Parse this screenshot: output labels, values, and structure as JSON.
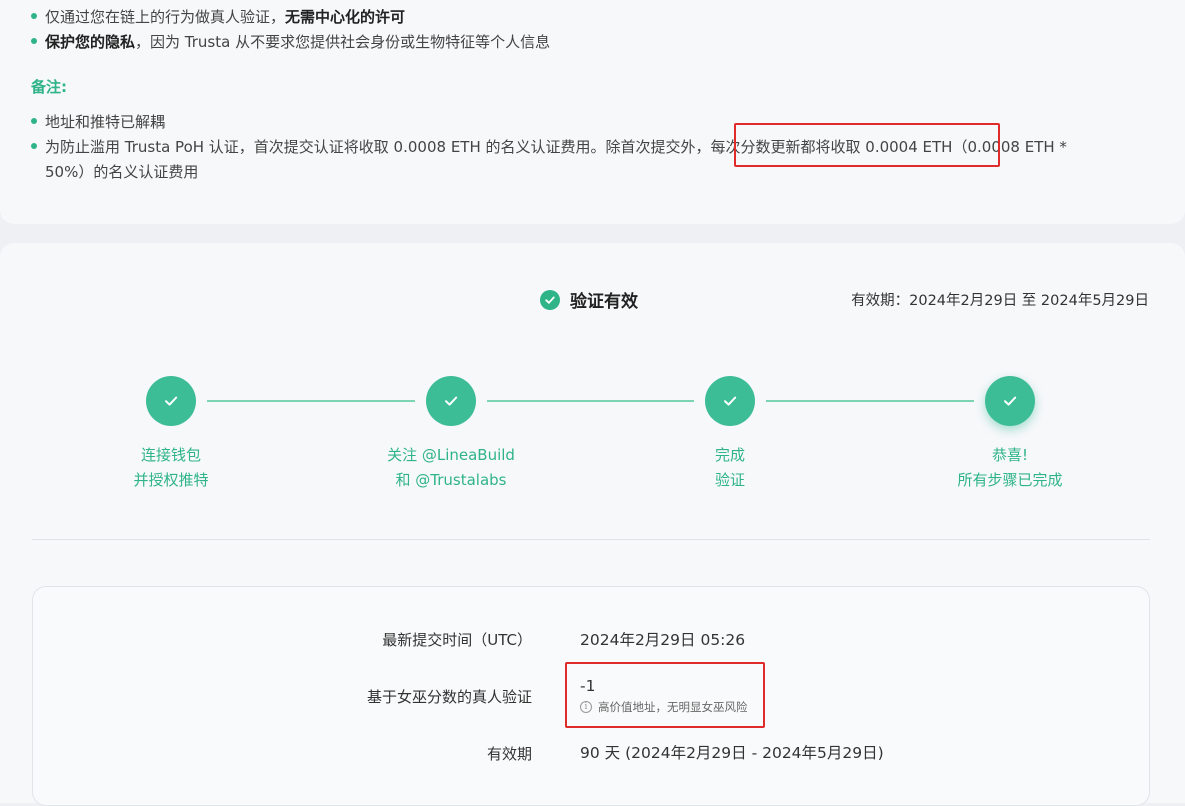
{
  "benefits": {
    "line1_prefix": "仅通过您在链上的行为做真人验证，",
    "line1_bold": "无需中心化的许可",
    "line2_bold": "保护您的隐私",
    "line2_rest": "，因为 Trusta 从不要求您提供社会身份或生物特征等个人信息"
  },
  "notes": {
    "title": "备注:",
    "item1": "地址和推特已解耦",
    "item2_part1": "为防止滥用 Trusta PoH 认证，首次提交认证将收取 0.0008 ETH 的名义认证费用。除首次提交外，",
    "item2_highlight": "每次分数更新都将收取 0.0004 ETH",
    "item2_part2": "（0.0008 ETH *",
    "item2_line2": "50%）的名义认证费用"
  },
  "status": {
    "label": "验证有效",
    "validity": "有效期：2024年2月29日 至 2024年5月29日"
  },
  "steps": [
    {
      "line1": "连接钱包",
      "line2": "并授权推特"
    },
    {
      "line1": "关注 @LineaBuild",
      "line2": "和 @Trustalabs"
    },
    {
      "line1": "完成",
      "line2": "验证"
    },
    {
      "line1": "恭喜!",
      "line2": "所有步骤已完成"
    }
  ],
  "details": {
    "submit_time_label": "最新提交时间（UTC）",
    "submit_time_value": "2024年2月29日 05:26",
    "score_label": "基于女巫分数的真人验证",
    "score_value": "-1",
    "score_note": "高价值地址，无明显女巫风险",
    "validity_label": "有效期",
    "validity_value": "90 天 (2024年2月29日 - 2024年5月29日)"
  },
  "colors": {
    "accent": "#2fb488",
    "highlight_box": "#e02b2b"
  }
}
